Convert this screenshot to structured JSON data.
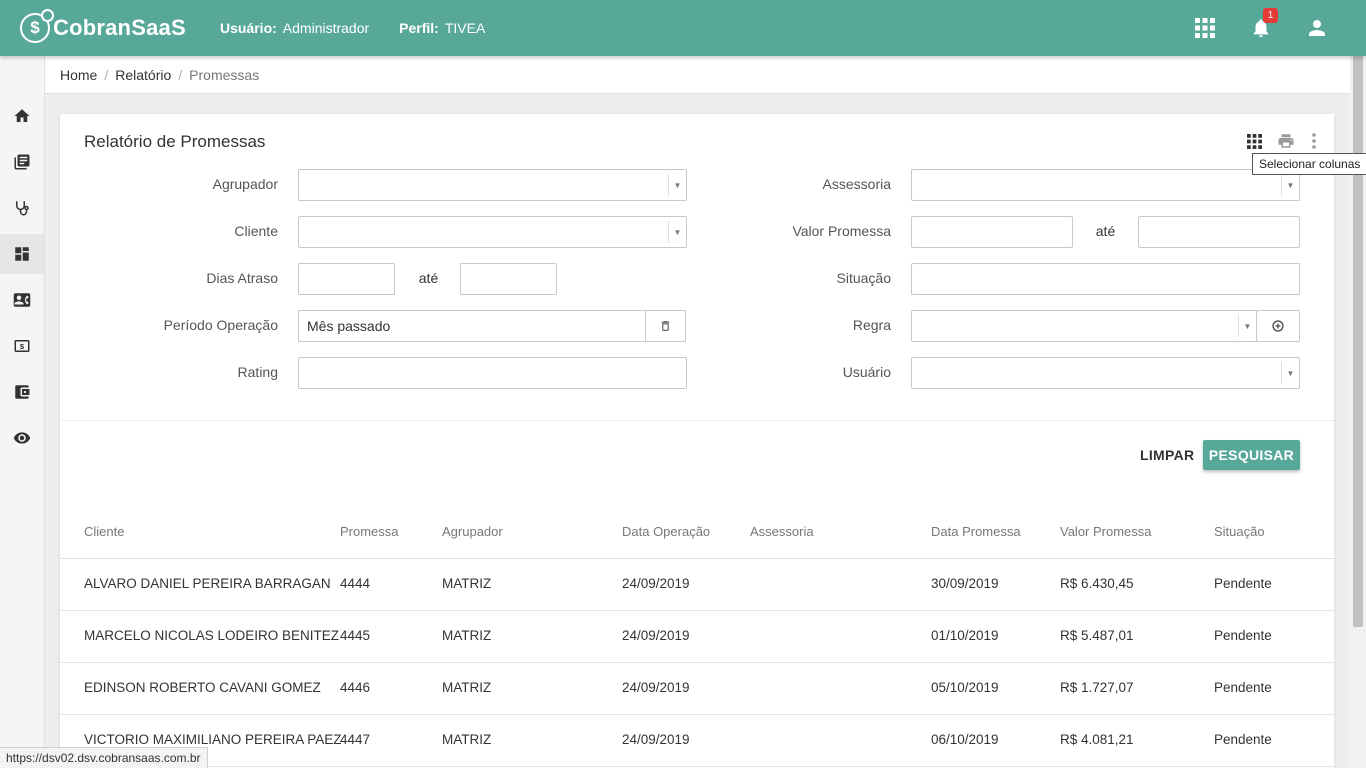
{
  "header": {
    "brand": "CobranSaaS",
    "user_label": "Usuário:",
    "user_value": "Administrador",
    "profile_label": "Perfil:",
    "profile_value": "TIVEA",
    "notification_count": "1",
    "icons": [
      "apps-grid-icon",
      "bell-icon",
      "user-icon"
    ]
  },
  "sidebar": {
    "items": [
      "home-icon",
      "book-icon",
      "stethoscope-icon",
      "dashboard-icon",
      "contact-card-icon",
      "money-icon",
      "wallet-icon",
      "eye-icon"
    ],
    "active_index": 3
  },
  "breadcrumb": {
    "items": [
      "Home",
      "Relatório"
    ],
    "current": "Promessas"
  },
  "report": {
    "title": "Relatório de Promessas",
    "tooltip": "Selecionar colunas"
  },
  "filters": {
    "agrupador": {
      "label": "Agrupador",
      "value": ""
    },
    "cliente": {
      "label": "Cliente",
      "value": ""
    },
    "dias_atraso": {
      "label": "Dias Atraso",
      "from": "",
      "to_label": "até",
      "to": ""
    },
    "periodo_operacao": {
      "label": "Período Operação",
      "value": "Mês passado"
    },
    "rating": {
      "label": "Rating",
      "value": ""
    },
    "assessoria": {
      "label": "Assessoria",
      "value": ""
    },
    "valor_promessa": {
      "label": "Valor Promessa",
      "from": "",
      "to_label": "até",
      "to": ""
    },
    "situacao": {
      "label": "Situação",
      "value": ""
    },
    "regra": {
      "label": "Regra",
      "value": ""
    },
    "usuario": {
      "label": "Usuário",
      "value": ""
    }
  },
  "actions": {
    "clear_label": "LIMPAR",
    "search_label": "PESQUISAR"
  },
  "table": {
    "columns": [
      "Cliente",
      "Promessa",
      "Agrupador",
      "Data Operação",
      "Assessoria",
      "Data Promessa",
      "Valor Promessa",
      "Situação"
    ],
    "rows": [
      [
        "ALVARO DANIEL PEREIRA BARRAGAN",
        "4444",
        "MATRIZ",
        "24/09/2019",
        "",
        "30/09/2019",
        "R$ 6.430,45",
        "Pendente"
      ],
      [
        "MARCELO NICOLAS LODEIRO BENITEZ",
        "4445",
        "MATRIZ",
        "24/09/2019",
        "",
        "01/10/2019",
        "R$ 5.487,01",
        "Pendente"
      ],
      [
        "EDINSON ROBERTO CAVANI GOMEZ",
        "4446",
        "MATRIZ",
        "24/09/2019",
        "",
        "05/10/2019",
        "R$ 1.727,07",
        "Pendente"
      ],
      [
        "VICTORIO MAXIMILIANO PEREIRA PAEZ",
        "4447",
        "MATRIZ",
        "24/09/2019",
        "",
        "06/10/2019",
        "R$ 4.081,21",
        "Pendente"
      ]
    ]
  },
  "status_url": "https://dsv02.dsv.cobransaas.com.br",
  "colors": {
    "primary": "#58a89a",
    "badge": "#e53935"
  }
}
